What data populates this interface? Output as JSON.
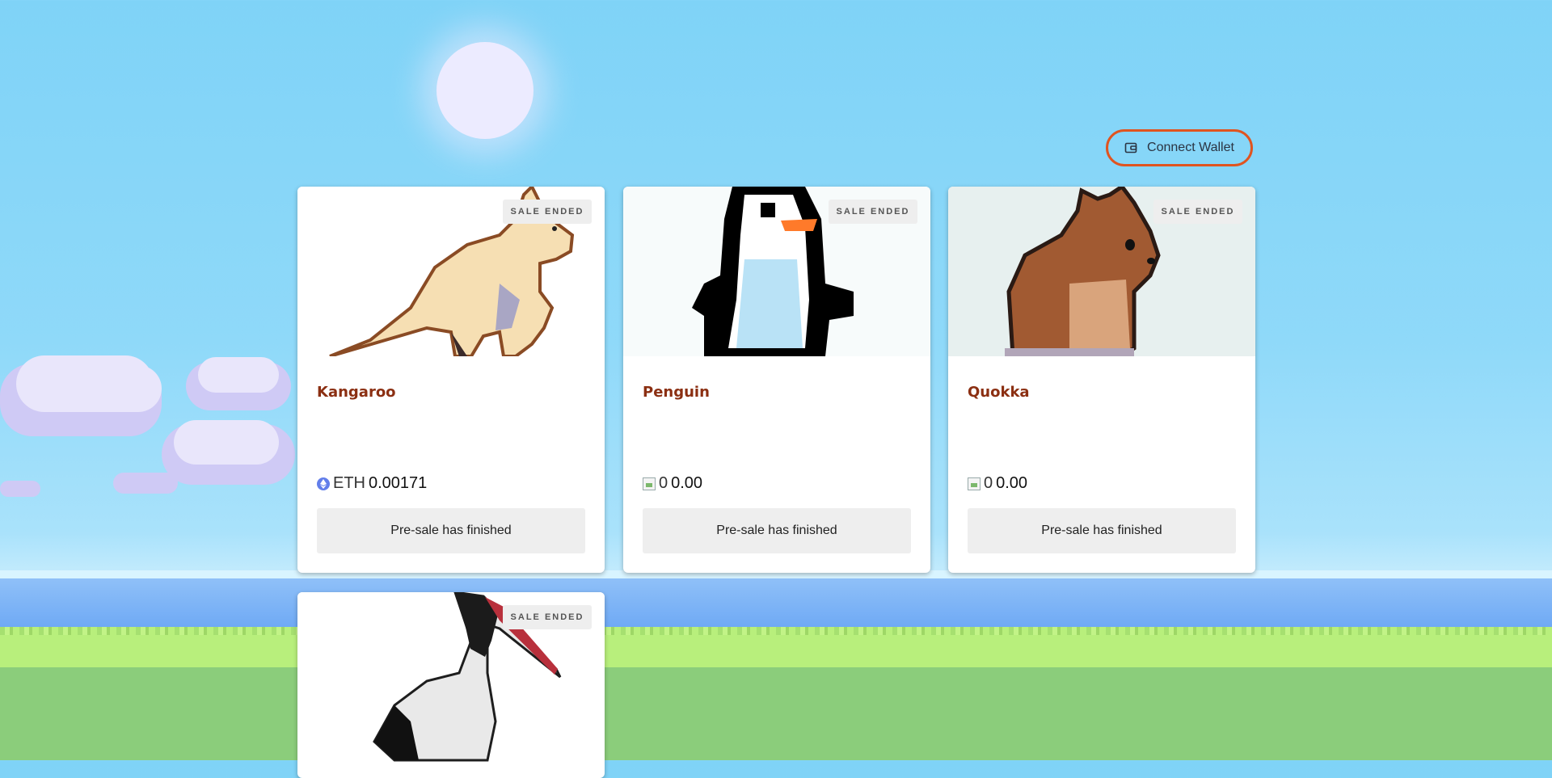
{
  "header": {
    "connect_label": "Connect Wallet",
    "connect_icon": "wallet-icon",
    "accent_color": "#e0541f"
  },
  "cards": [
    {
      "title": "Kangaroo",
      "badge": "SALE ENDED",
      "price_currency": "ETH",
      "price_value": "0.00171",
      "price_icon": "ethereum-icon",
      "button_label": "Pre-sale has finished",
      "art_bg": "#ffffff"
    },
    {
      "title": "Penguin",
      "badge": "SALE ENDED",
      "price_currency": "0",
      "price_value": "0.00",
      "price_icon": "broken-image-icon",
      "button_label": "Pre-sale has finished",
      "art_bg": "#f7fbfb"
    },
    {
      "title": "Quokka",
      "badge": "SALE ENDED",
      "price_currency": "0",
      "price_value": "0.00",
      "price_icon": "broken-image-icon",
      "button_label": "Pre-sale has finished",
      "art_bg": "#e7f0ef"
    },
    {
      "title": "",
      "badge": "SALE ENDED",
      "art_bg": "#ffffff"
    }
  ],
  "colors": {
    "title": "#8b2f12",
    "sky": "#7fd3f7",
    "water": "#6aa6f4",
    "grass": "#8bcd7b"
  }
}
